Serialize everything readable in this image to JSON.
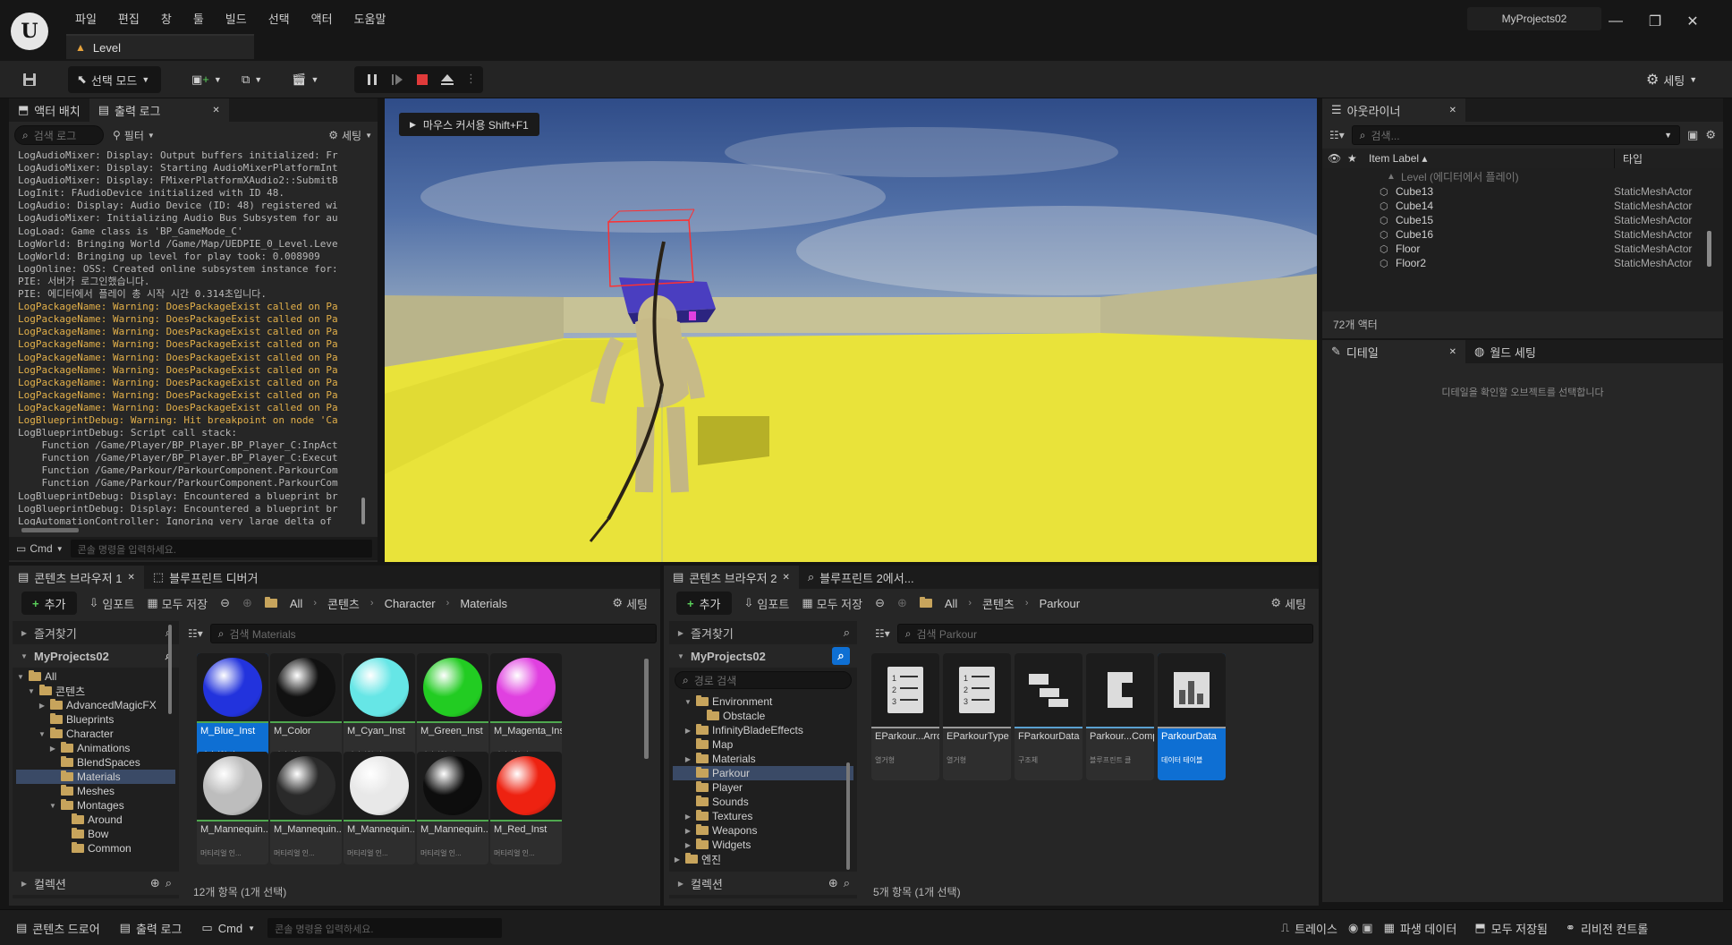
{
  "app": {
    "menu": [
      "파일",
      "편집",
      "창",
      "툴",
      "빌드",
      "선택",
      "액터",
      "도움말"
    ],
    "level_tab": "Level",
    "project_name": "MyProjects02",
    "window_controls": [
      "minimize-icon",
      "restore-icon",
      "close-icon"
    ]
  },
  "toolbar": {
    "select_mode": "선택 모드",
    "settings": "세팅"
  },
  "left_panel": {
    "tabs": [
      "액터 배치",
      "출력 로그"
    ],
    "search_placeholder": "검색 로그",
    "filter_label": "필터",
    "settings_label": "세팅",
    "log_lines": [
      {
        "t": "LogAudioMixer: Display: Output buffers initialized: Fr",
        "w": false
      },
      {
        "t": "LogAudioMixer: Display: Starting AudioMixerPlatformInt",
        "w": false
      },
      {
        "t": "LogAudioMixer: Display: FMixerPlatformXAudio2::SubmitB",
        "w": false
      },
      {
        "t": "LogInit: FAudioDevice initialized with ID 48.",
        "w": false
      },
      {
        "t": "LogAudio: Display: Audio Device (ID: 48) registered wi",
        "w": false
      },
      {
        "t": "LogAudioMixer: Initializing Audio Bus Subsystem for au",
        "w": false
      },
      {
        "t": "LogLoad: Game class is 'BP_GameMode_C'",
        "w": false
      },
      {
        "t": "LogWorld: Bringing World /Game/Map/UEDPIE_0_Level.Leve",
        "w": false
      },
      {
        "t": "LogWorld: Bringing up level for play took: 0.008909",
        "w": false
      },
      {
        "t": "LogOnline: OSS: Created online subsystem instance for:",
        "w": false
      },
      {
        "t": "PIE: 서버가 로그인했습니다.",
        "w": false
      },
      {
        "t": "PIE: 에디터에서 플레이 총 시작 시간 0.314초입니다.",
        "w": false
      },
      {
        "t": "LogPackageName: Warning: DoesPackageExist called on Pa",
        "w": true
      },
      {
        "t": "LogPackageName: Warning: DoesPackageExist called on Pa",
        "w": true
      },
      {
        "t": "LogPackageName: Warning: DoesPackageExist called on Pa",
        "w": true
      },
      {
        "t": "LogPackageName: Warning: DoesPackageExist called on Pa",
        "w": true
      },
      {
        "t": "LogPackageName: Warning: DoesPackageExist called on Pa",
        "w": true
      },
      {
        "t": "LogPackageName: Warning: DoesPackageExist called on Pa",
        "w": true
      },
      {
        "t": "LogPackageName: Warning: DoesPackageExist called on Pa",
        "w": true
      },
      {
        "t": "LogPackageName: Warning: DoesPackageExist called on Pa",
        "w": true
      },
      {
        "t": "LogPackageName: Warning: DoesPackageExist called on Pa",
        "w": true
      },
      {
        "t": "LogBlueprintDebug: Warning: Hit breakpoint on node 'Ca",
        "w": true
      },
      {
        "t": "LogBlueprintDebug: Script call stack:",
        "w": false
      },
      {
        "t": "    Function /Game/Player/BP_Player.BP_Player_C:InpAct",
        "w": false
      },
      {
        "t": "    Function /Game/Player/BP_Player.BP_Player_C:Execut",
        "w": false
      },
      {
        "t": "    Function /Game/Parkour/ParkourComponent.ParkourCom",
        "w": false
      },
      {
        "t": "    Function /Game/Parkour/ParkourComponent.ParkourCom",
        "w": false
      },
      {
        "t": "LogBlueprintDebug: Display: Encountered a blueprint br",
        "w": false
      },
      {
        "t": "LogBlueprintDebug: Display: Encountered a blueprint br",
        "w": false
      },
      {
        "t": "LogAutomationController: Ignoring very large delta of",
        "w": false
      }
    ],
    "cmd_label": "Cmd",
    "console_placeholder": "콘솔 명령을 입력하세요."
  },
  "viewport": {
    "notice": "마우스 커서용 Shift+F1"
  },
  "outliner": {
    "title": "아웃라이너",
    "search_placeholder": "검색...",
    "col_label": "Item Label",
    "col_type": "타입",
    "level_row": "Level (에디터에서 플레이)",
    "items": [
      {
        "label": "Cube13",
        "type": "StaticMeshActor"
      },
      {
        "label": "Cube14",
        "type": "StaticMeshActor"
      },
      {
        "label": "Cube15",
        "type": "StaticMeshActor"
      },
      {
        "label": "Cube16",
        "type": "StaticMeshActor"
      },
      {
        "label": "Floor",
        "type": "StaticMeshActor"
      },
      {
        "label": "Floor2",
        "type": "StaticMeshActor"
      }
    ],
    "actor_count": "72개 액터"
  },
  "details": {
    "tab_details": "디테일",
    "tab_world": "월드 세팅",
    "empty_msg": "디테일을 확인할 오브젝트를 선택합니다"
  },
  "cb1": {
    "tab": "콘텐츠 브라우저 1",
    "tab2": "블루프린트 디버거",
    "add": "추가",
    "import": "임포트",
    "save_all": "모두 저장",
    "crumbs": [
      "All",
      "콘텐츠",
      "Character",
      "Materials"
    ],
    "settings": "세팅",
    "favorites": "즐겨찾기",
    "project": "MyProjects02",
    "search_placeholder": "검색 Materials",
    "tree": [
      {
        "label": "All",
        "level": 0,
        "open": true
      },
      {
        "label": "콘텐츠",
        "level": 1,
        "open": true
      },
      {
        "label": "AdvancedMagicFX",
        "level": 2,
        "open": false
      },
      {
        "label": "Blueprints",
        "level": 2,
        "open": null
      },
      {
        "label": "Character",
        "level": 2,
        "open": true
      },
      {
        "label": "Animations",
        "level": 3,
        "open": false
      },
      {
        "label": "BlendSpaces",
        "level": 3,
        "open": null
      },
      {
        "label": "Materials",
        "level": 3,
        "open": null
      },
      {
        "label": "Meshes",
        "level": 3,
        "open": null
      },
      {
        "label": "Montages",
        "level": 3,
        "open": true
      },
      {
        "label": "Around",
        "level": 4,
        "open": null
      },
      {
        "label": "Bow",
        "level": 4,
        "open": null
      },
      {
        "label": "Common",
        "level": 4,
        "open": null
      }
    ],
    "assets": [
      {
        "name": "M_Blue_Inst",
        "type": "머티리얼 인...",
        "color": "#2233dd"
      },
      {
        "name": "M_Color",
        "type": "머티리얼",
        "color": "#111111"
      },
      {
        "name": "M_Cyan_Inst",
        "type": "머티리얼 인...",
        "color": "#66e6e6"
      },
      {
        "name": "M_Green_Inst",
        "type": "머티리얼 인...",
        "color": "#22cc22"
      },
      {
        "name": "M_Magenta_Inst",
        "type": "머티리얼 인...",
        "color": "#e040e0"
      },
      {
        "name": "M_Mannequin...",
        "type": "머티리얼 인...",
        "color": "#bdbdbd"
      },
      {
        "name": "M_Mannequin...",
        "type": "머티리얼 인...",
        "color": "#2a2a2a"
      },
      {
        "name": "M_Mannequin...",
        "type": "머티리얼 인...",
        "color": "#e8e8e8"
      },
      {
        "name": "M_Mannequin...",
        "type": "머티리얼 인...",
        "color": "#0d0d0d"
      },
      {
        "name": "M_Red_Inst",
        "type": "머티리얼 인...",
        "color": "#ee2211"
      }
    ],
    "collection": "컬렉션",
    "count": "12개 항목 (1개 선택)"
  },
  "cb2": {
    "tab": "콘텐츠 브라우저 2",
    "tab2": "블루프린트 2에서...",
    "add": "추가",
    "import": "임포트",
    "save_all": "모두 저장",
    "crumbs": [
      "All",
      "콘텐츠",
      "Parkour"
    ],
    "settings": "세팅",
    "favorites": "즐겨찾기",
    "project": "MyProjects02",
    "path_search": "경로 검색",
    "search_placeholder": "검색 Parkour",
    "tree": [
      {
        "label": "Environment",
        "level": 1,
        "open": true
      },
      {
        "label": "Obstacle",
        "level": 2,
        "open": null
      },
      {
        "label": "InfinityBladeEffects",
        "level": 1,
        "open": false
      },
      {
        "label": "Map",
        "level": 1,
        "open": null
      },
      {
        "label": "Materials",
        "level": 1,
        "open": false
      },
      {
        "label": "Parkour",
        "level": 1,
        "open": null
      },
      {
        "label": "Player",
        "level": 1,
        "open": null
      },
      {
        "label": "Sounds",
        "level": 1,
        "open": null
      },
      {
        "label": "Textures",
        "level": 1,
        "open": false
      },
      {
        "label": "Weapons",
        "level": 1,
        "open": false
      },
      {
        "label": "Widgets",
        "level": 1,
        "open": false
      },
      {
        "label": "엔진",
        "level": 0,
        "open": false
      }
    ],
    "assets": [
      {
        "name": "EParkour...ArrowType",
        "type": "열거형",
        "icon": "enum-icon"
      },
      {
        "name": "EParkourType",
        "type": "열거형",
        "icon": "enum-icon"
      },
      {
        "name": "FParkourData",
        "type": "구조체",
        "icon": "struct-icon"
      },
      {
        "name": "Parkour...Component",
        "type": "블루프린트 클",
        "icon": "blueprint-component-icon"
      },
      {
        "name": "ParkourData",
        "type": "데이터 테이블",
        "icon": "data-table-icon"
      }
    ],
    "collection": "컬렉션",
    "count": "5개 항목 (1개 선택)"
  },
  "statusbar": {
    "drawer": "콘텐츠 드로어",
    "output": "출력 로그",
    "cmd": "Cmd",
    "console_placeholder": "콘솔 명령을 입력하세요.",
    "trace": "트레이스",
    "derived": "파생 데이터",
    "saved": "모두 저장됨",
    "revision": "리비전 컨트롤"
  }
}
